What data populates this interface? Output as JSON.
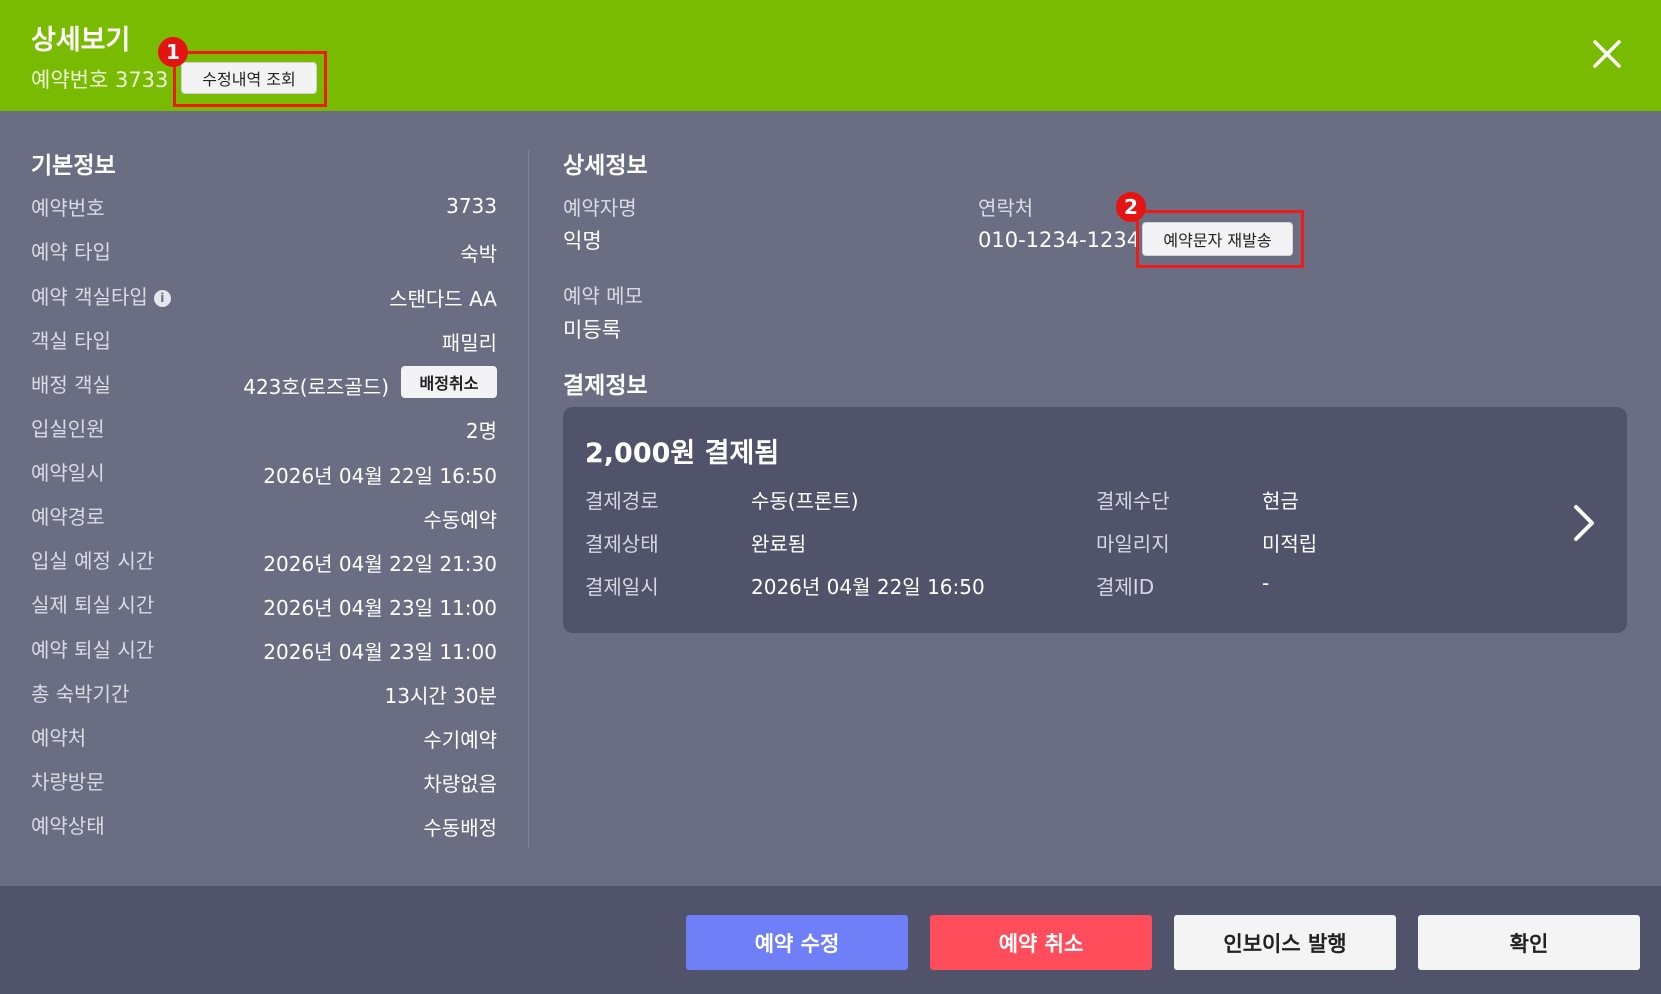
{
  "header": {
    "title": "상세보기",
    "subtitle": "예약번호 3733",
    "history_button": "수정내역 조회",
    "badge1": "1",
    "badge2": "2"
  },
  "basic_info": {
    "title": "기본정보",
    "rows": [
      {
        "label": "예약번호",
        "value": "3733"
      },
      {
        "label": "예약 타입",
        "value": "숙박"
      },
      {
        "label": "예약 객실타입",
        "value": "스탠다드 AA"
      },
      {
        "label": "객실 타입",
        "value": "패밀리"
      },
      {
        "label": "배정 객실",
        "value": "423호(로즈골드)"
      },
      {
        "label": "입실인원",
        "value": "2명"
      },
      {
        "label": "예약일시",
        "value": "2026년 04월 22일 16:50"
      },
      {
        "label": "예약경로",
        "value": "수동예약"
      },
      {
        "label": "입실 예정 시간",
        "value": "2026년 04월 22일 21:30"
      },
      {
        "label": "실제 퇴실 시간",
        "value": "2026년 04월 23일 11:00"
      },
      {
        "label": "예약 퇴실 시간",
        "value": "2026년 04월 23일 11:00"
      },
      {
        "label": "총 숙박기간",
        "value": "13시간 30분"
      },
      {
        "label": "예약처",
        "value": "수기예약"
      },
      {
        "label": "차량방문",
        "value": "차량없음"
      },
      {
        "label": "예약상태",
        "value": "수동배정"
      }
    ],
    "info_icon_glyph": "i",
    "unassign_button": "배정취소"
  },
  "detail_info": {
    "title": "상세정보",
    "booker_label": "예약자명",
    "booker_value": "익명",
    "contact_label": "연락처",
    "contact_value": "010-1234-1234",
    "resend_button": "예약문자 재발송",
    "memo_label": "예약 메모",
    "memo_value": "미등록"
  },
  "payment_info": {
    "title": "결제정보",
    "summary": "2,000원 결제됨",
    "left": [
      {
        "label": "결제경로",
        "value": "수동(프론트)"
      },
      {
        "label": "결제상태",
        "value": "완료됨"
      },
      {
        "label": "결제일시",
        "value": "2026년 04월 22일 16:50"
      }
    ],
    "right": [
      {
        "label": "결제수단",
        "value": "현금"
      },
      {
        "label": "마일리지",
        "value": "미적립"
      },
      {
        "label": "결제ID",
        "value": "-"
      }
    ]
  },
  "footer": {
    "edit_button": "예약 수정",
    "cancel_button": "예약 취소",
    "invoice_button": "인보이스 발행",
    "confirm_button": "확인"
  },
  "colors": {
    "header_green": "#79bb00",
    "body_bg": "#6b6e82",
    "card_bg": "#505369",
    "footer_bg": "#505369",
    "edit_blue": "#6f7ff7",
    "cancel_red": "#ff4d5b",
    "highlight_red": "#ef1b1b"
  }
}
